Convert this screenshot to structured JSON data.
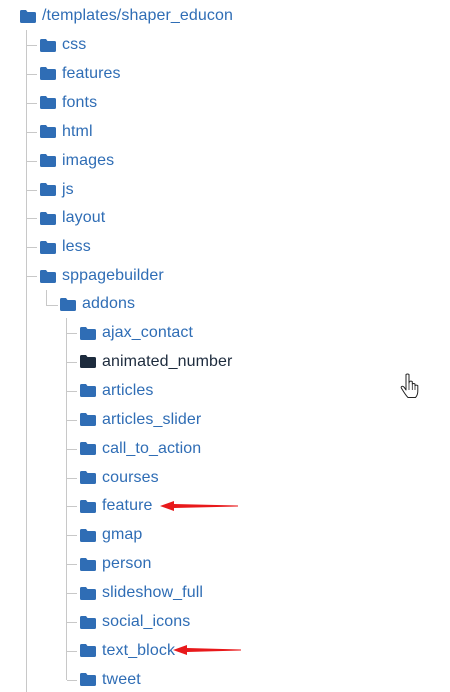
{
  "root": {
    "path": "/templates/shaper_educon",
    "icon": "folder-icon"
  },
  "colors": {
    "folder": "#2f6db5",
    "folder_active": "#1d2b3d",
    "link_text": "#2f6db5",
    "active_text": "#1d2b3d",
    "tree_lines": "#c8c8c8",
    "annotation_arrow": "#e8191b"
  },
  "level1": [
    {
      "label": "css"
    },
    {
      "label": "features"
    },
    {
      "label": "fonts"
    },
    {
      "label": "html"
    },
    {
      "label": "images"
    },
    {
      "label": "js"
    },
    {
      "label": "layout"
    },
    {
      "label": "less"
    },
    {
      "label": "sppagebuilder"
    }
  ],
  "level2": [
    {
      "label": "addons"
    }
  ],
  "level3": [
    {
      "label": "ajax_contact"
    },
    {
      "label": "animated_number",
      "state": "active"
    },
    {
      "label": "articles"
    },
    {
      "label": "articles_slider"
    },
    {
      "label": "call_to_action"
    },
    {
      "label": "courses"
    },
    {
      "label": "feature",
      "annotated": true
    },
    {
      "label": "gmap"
    },
    {
      "label": "person"
    },
    {
      "label": "slideshow_full"
    },
    {
      "label": "social_icons"
    },
    {
      "label": "text_block",
      "annotated": true
    },
    {
      "label": "tweet"
    }
  ],
  "annotations": [
    {
      "type": "red-arrow",
      "points_to": "feature"
    },
    {
      "type": "red-arrow",
      "points_to": "text_block"
    }
  ],
  "cursor": {
    "icon": "hand-pointer-icon"
  }
}
